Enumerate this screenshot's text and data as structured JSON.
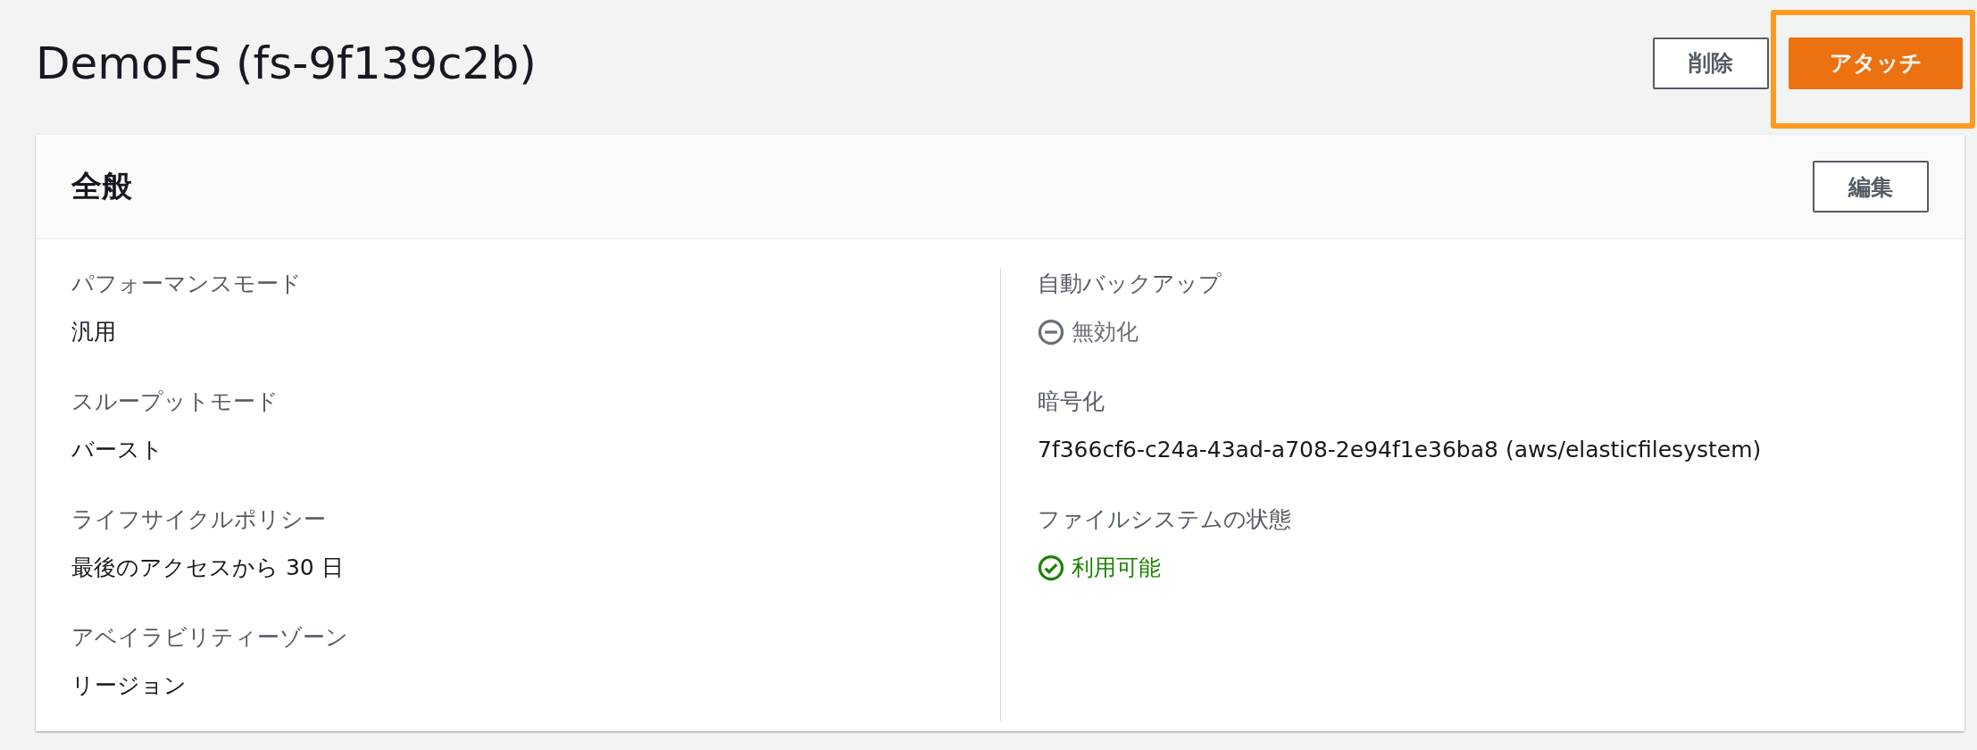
{
  "page": {
    "title": "DemoFS (fs-9f139c2b)"
  },
  "actions": [
    {
      "label": "削除",
      "kind": "normal",
      "highlighted": false
    },
    {
      "label": "アタッチ",
      "kind": "primary",
      "highlighted": true
    }
  ],
  "panel": {
    "title": "全般",
    "edit_button": "編集",
    "left": [
      {
        "label": "パフォーマンスモード",
        "value": "汎用"
      },
      {
        "label": "スループットモード",
        "value": "バースト"
      },
      {
        "label": "ライフサイクルポリシー",
        "value": "最後のアクセスから 30 日"
      },
      {
        "label": "アベイラビリティーゾーン",
        "value": "リージョン"
      }
    ],
    "right": [
      {
        "label": "自動バックアップ",
        "value": "無効化",
        "kind": "disabled"
      },
      {
        "label": "暗号化",
        "value": "7f366cf6-c24a-43ad-a708-2e94f1e36ba8 (aws/elasticfilesystem)"
      },
      {
        "label": "ファイルシステムの状態",
        "value": "利用可能",
        "kind": "available"
      }
    ]
  }
}
